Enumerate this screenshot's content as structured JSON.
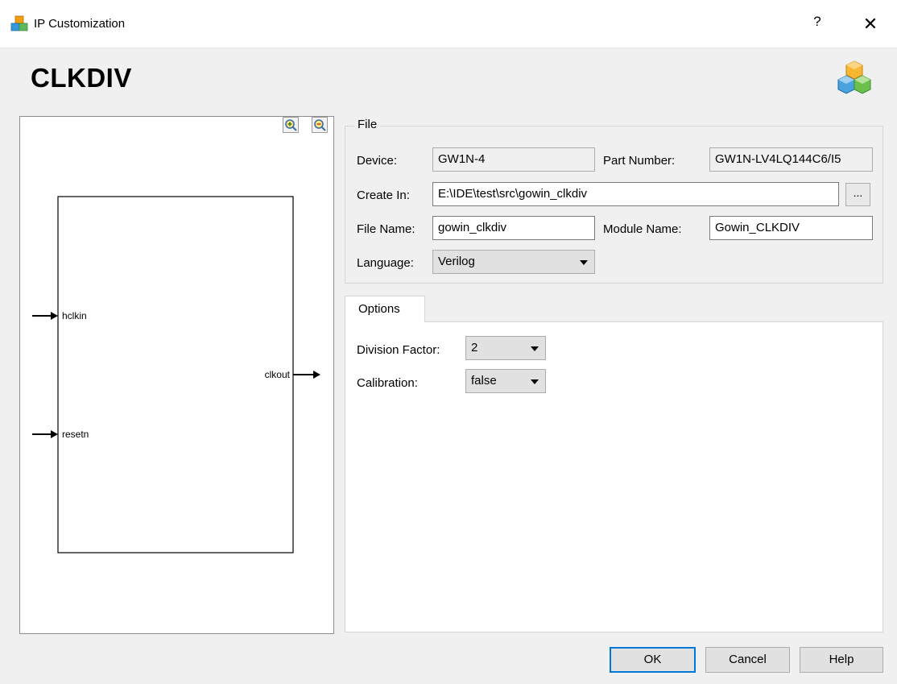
{
  "window": {
    "title": "IP Customization",
    "help_glyph": "?",
    "close_glyph": "✕"
  },
  "header": {
    "ip_name": "CLKDIV",
    "logo_icon": "cubes-icon"
  },
  "preview": {
    "ports_in": [
      "hclkin",
      "resetn"
    ],
    "ports_out": [
      "clkout"
    ],
    "zoom_in_icon": "zoom-in-icon",
    "zoom_out_icon": "zoom-out-icon"
  },
  "file_group": {
    "title": "File",
    "device_label": "Device:",
    "device_value": "GW1N-4",
    "part_number_label": "Part Number:",
    "part_number_value": "GW1N-LV4LQ144C6/I5",
    "create_in_label": "Create In:",
    "create_in_value": "E:\\IDE\\test\\src\\gowin_clkdiv",
    "browse_label": "...",
    "file_name_label": "File Name:",
    "file_name_value": "gowin_clkdiv",
    "module_name_label": "Module Name:",
    "module_name_value": "Gowin_CLKDIV",
    "language_label": "Language:",
    "language_value": "Verilog"
  },
  "options": {
    "tab_label": "Options",
    "division_factor_label": "Division Factor:",
    "division_factor_value": "2",
    "calibration_label": "Calibration:",
    "calibration_value": "false"
  },
  "buttons": {
    "ok": "OK",
    "cancel": "Cancel",
    "help": "Help"
  },
  "colors": {
    "default_button_border": "#0078d7",
    "logo_orange": "#f39c12",
    "logo_blue": "#3498db",
    "logo_green": "#5cb85c"
  }
}
